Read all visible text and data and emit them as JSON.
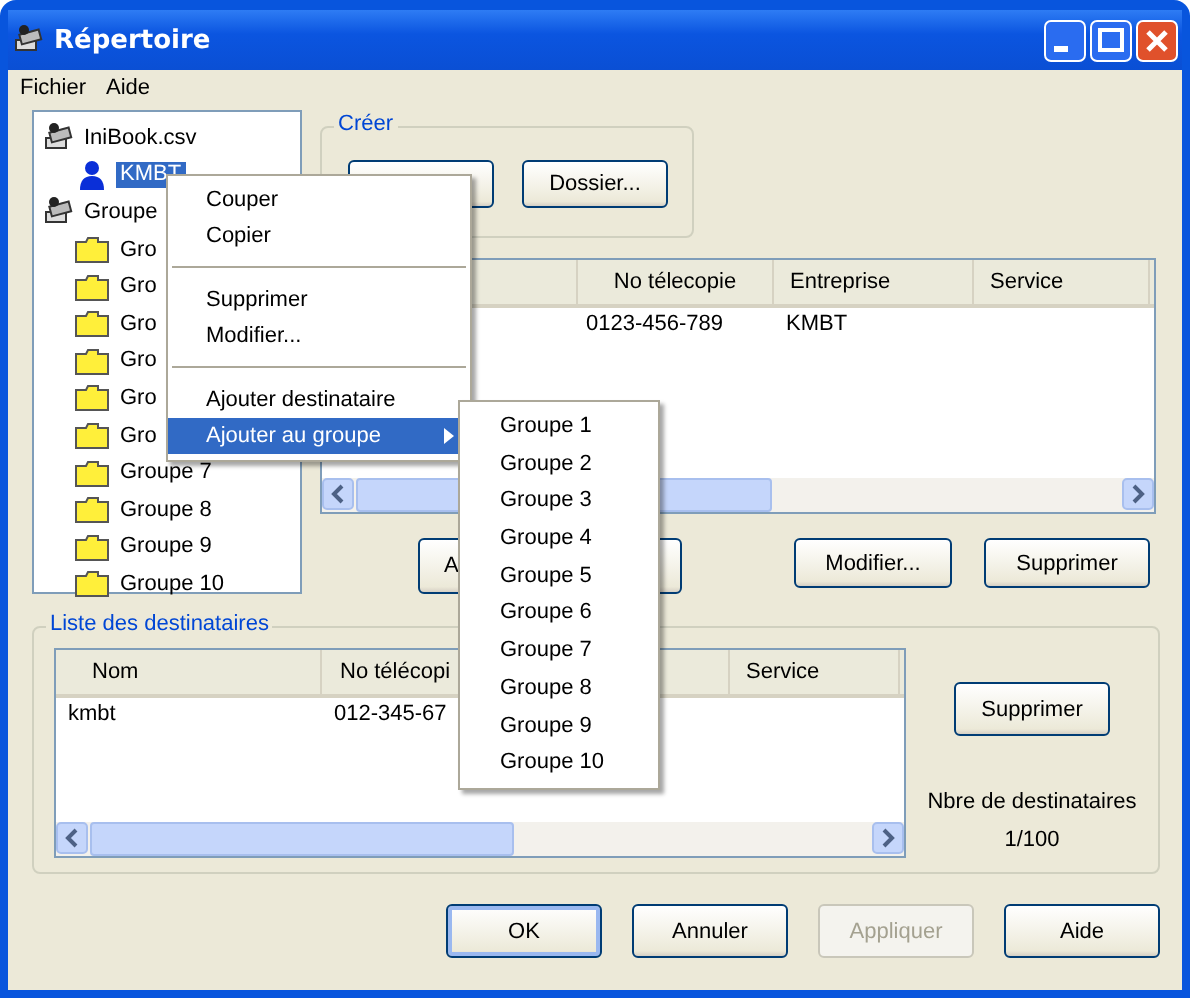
{
  "window": {
    "title": "Répertoire"
  },
  "menu_bar": [
    "Fichier",
    "Aide"
  ],
  "tree": [
    {
      "label": "IniBook.csv",
      "kind": "book",
      "selected": false,
      "children": [
        {
          "label": "KMBT",
          "kind": "person",
          "selected": true
        }
      ]
    },
    {
      "label": "Groupe",
      "kind": "book",
      "selected": false,
      "children": [
        {
          "label": "Gro",
          "kind": "folder",
          "selected": false
        },
        {
          "label": "Gro",
          "kind": "folder",
          "selected": false
        },
        {
          "label": "Gro",
          "kind": "folder",
          "selected": false
        },
        {
          "label": "Gro",
          "kind": "folder",
          "selected": false
        },
        {
          "label": "Gro",
          "kind": "folder",
          "selected": false
        },
        {
          "label": "Gro",
          "kind": "folder",
          "selected": false
        },
        {
          "label": "Groupe 7",
          "kind": "folder",
          "selected": false
        },
        {
          "label": "Groupe 8",
          "kind": "folder",
          "selected": false
        },
        {
          "label": "Groupe 9",
          "kind": "folder",
          "selected": false
        },
        {
          "label": "Groupe 10",
          "kind": "folder",
          "selected": false
        }
      ]
    }
  ],
  "create_group": {
    "title": "Créer",
    "buttons": [
      {
        "kind": "covered"
      },
      {
        "kind": "labeled",
        "label": "Dossier..."
      }
    ]
  },
  "contacts_table": {
    "columns": [
      {
        "kind": "covered"
      },
      {
        "kind": "labeled",
        "label": "No télecopie"
      },
      {
        "kind": "labeled",
        "label": "Entreprise"
      },
      {
        "kind": "labeled",
        "label": "Service"
      }
    ],
    "rows": [
      {
        "cells": [
          "",
          "0123-456-789",
          "KMBT"
        ]
      }
    ]
  },
  "contact_buttons": [
    {
      "label": "A"
    },
    {
      "label": "Modifier..."
    },
    {
      "label": "Supprimer"
    }
  ],
  "recipients": {
    "title": "Liste des destinataires",
    "columns": [
      {
        "kind": "labeled",
        "label": "Nom"
      },
      {
        "kind": "labeled",
        "label": "No télécopi"
      },
      {
        "kind": "covered"
      },
      {
        "kind": "labeled",
        "label": "Service"
      }
    ],
    "rows": [
      {
        "cells": [
          "kmbt",
          "012-345-67"
        ]
      }
    ],
    "button": "Supprimer",
    "count_label": "Nbre de destinataires",
    "count": "1/100"
  },
  "dialog_buttons": [
    {
      "label": "OK",
      "disabled": false,
      "default": true
    },
    {
      "label": "Annuler",
      "disabled": false,
      "default": false
    },
    {
      "label": "Appliquer",
      "disabled": true,
      "default": false
    },
    {
      "label": "Aide",
      "disabled": false,
      "default": false
    }
  ],
  "context_menu": [
    {
      "kind": "item",
      "label": "Couper",
      "selected": false
    },
    {
      "kind": "item",
      "label": "Copier",
      "selected": false
    },
    {
      "kind": "separator"
    },
    {
      "kind": "item",
      "label": "Supprimer",
      "selected": false
    },
    {
      "kind": "item",
      "label": "Modifier...",
      "selected": false
    },
    {
      "kind": "separator"
    },
    {
      "kind": "item",
      "label": "Ajouter destinataire",
      "selected": false
    },
    {
      "kind": "submenu",
      "label": "Ajouter au groupe",
      "selected": true
    }
  ],
  "submenu": [
    {
      "label": "Groupe 1"
    },
    {
      "label": "Groupe 2"
    },
    {
      "label": "Groupe 3"
    },
    {
      "label": "Groupe 4"
    },
    {
      "label": "Groupe 5"
    },
    {
      "label": "Groupe 6"
    },
    {
      "label": "Groupe 7"
    },
    {
      "label": "Groupe 8"
    },
    {
      "label": "Groupe 9"
    },
    {
      "label": "Groupe 10"
    }
  ]
}
